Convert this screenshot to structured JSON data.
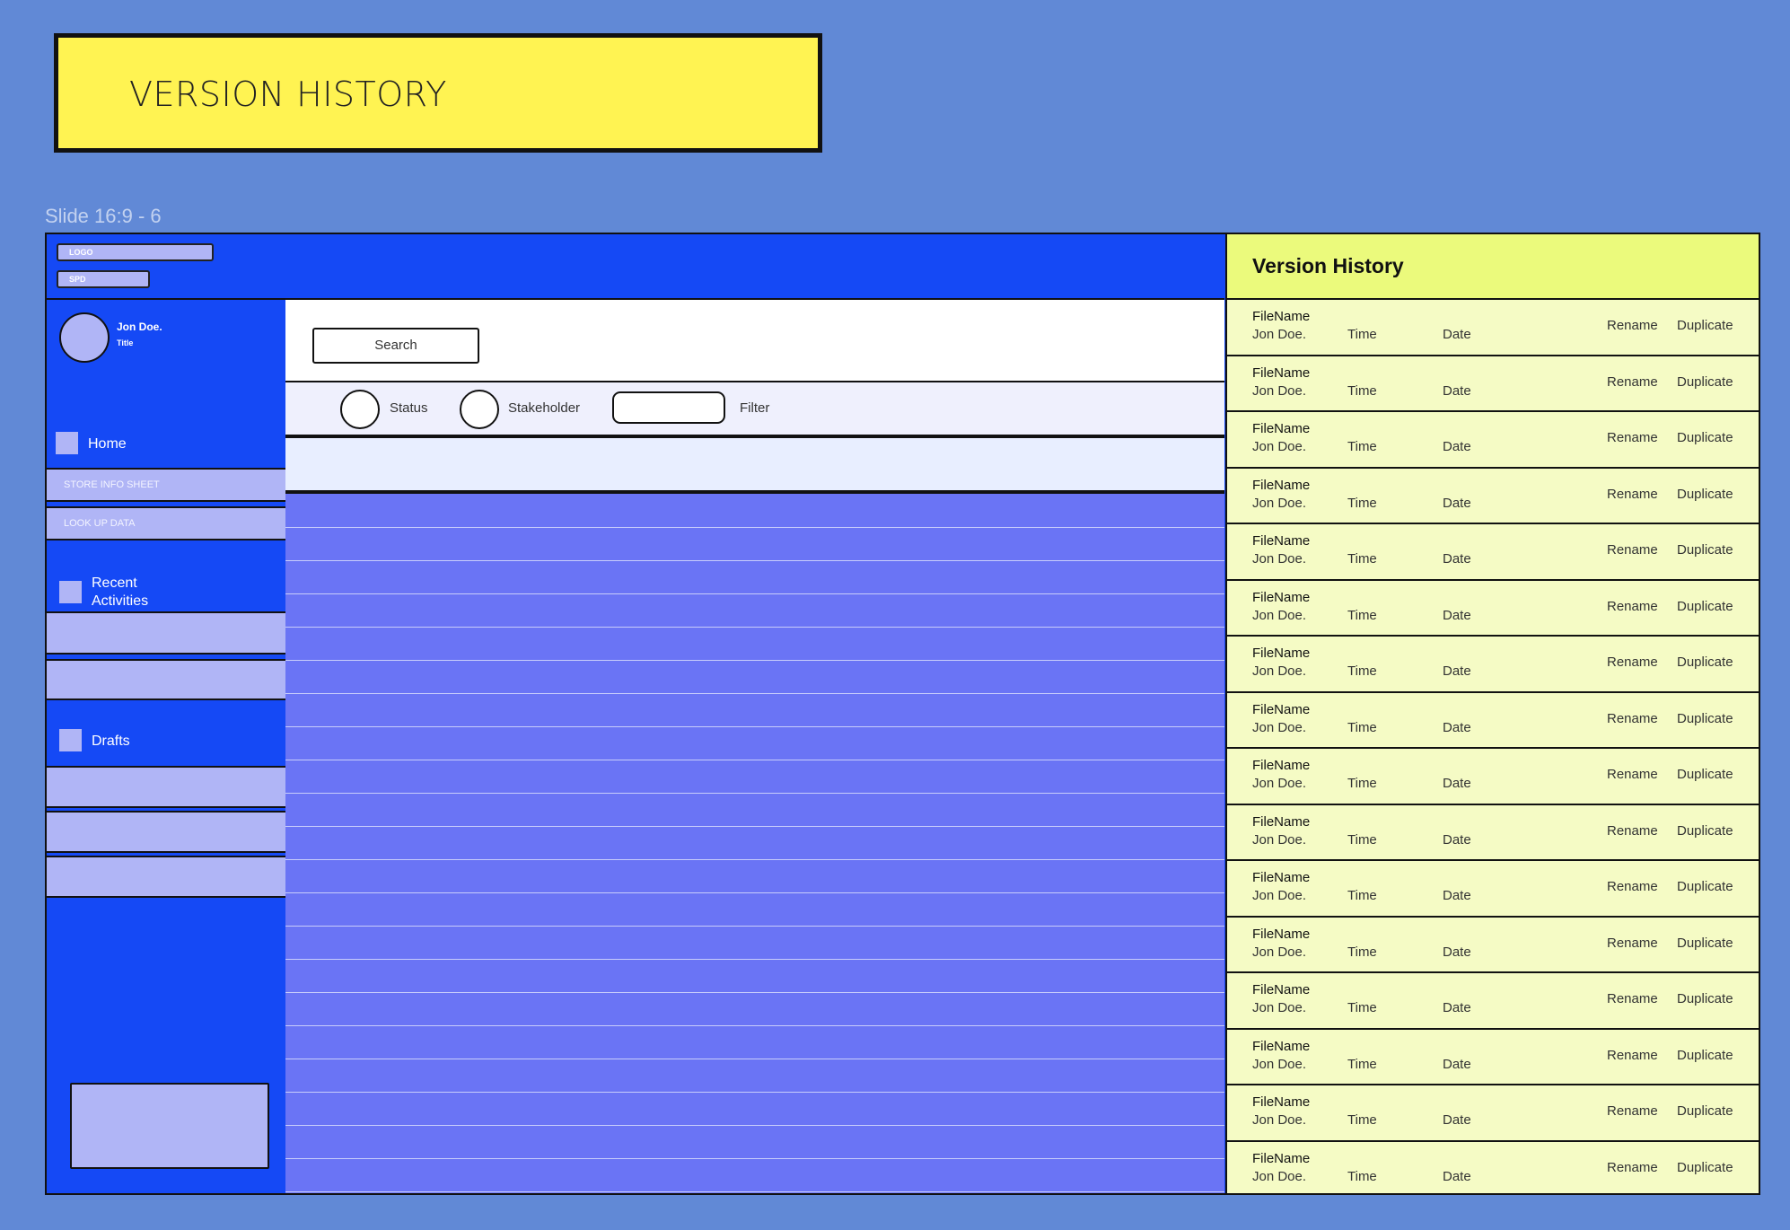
{
  "banner": {
    "title": "VERSION HISTORY"
  },
  "slide_label": "Slide 16:9 - 6",
  "topbar": {
    "logo": "LOGO",
    "spd": "SPD"
  },
  "sidebar": {
    "user_name": "Jon Doe.",
    "user_title": "Title",
    "home": "Home",
    "store_info": "STORE INFO SHEET",
    "look_up": "LOOK UP DATA",
    "recent_line1": "Recent",
    "recent_line2": "Activities",
    "drafts": "Drafts"
  },
  "toolbar": {
    "search": "Search",
    "status": "Status",
    "stakeholder": "Stakeholder",
    "filter": "Filter"
  },
  "version_panel": {
    "title": "Version History",
    "rows": [
      {
        "file": "FileName",
        "user": "Jon Doe.",
        "time": "Time",
        "date": "Date",
        "rename": "Rename",
        "duplicate": "Duplicate"
      },
      {
        "file": "FileName",
        "user": "Jon Doe.",
        "time": "Time",
        "date": "Date",
        "rename": "Rename",
        "duplicate": "Duplicate"
      },
      {
        "file": "FileName",
        "user": "Jon Doe.",
        "time": "Time",
        "date": "Date",
        "rename": "Rename",
        "duplicate": "Duplicate"
      },
      {
        "file": "FileName",
        "user": "Jon Doe.",
        "time": "Time",
        "date": "Date",
        "rename": "Rename",
        "duplicate": "Duplicate"
      },
      {
        "file": "FileName",
        "user": "Jon Doe.",
        "time": "Time",
        "date": "Date",
        "rename": "Rename",
        "duplicate": "Duplicate"
      },
      {
        "file": "FileName",
        "user": "Jon Doe.",
        "time": "Time",
        "date": "Date",
        "rename": "Rename",
        "duplicate": "Duplicate"
      },
      {
        "file": "FileName",
        "user": "Jon Doe.",
        "time": "Time",
        "date": "Date",
        "rename": "Rename",
        "duplicate": "Duplicate"
      },
      {
        "file": "FileName",
        "user": "Jon Doe.",
        "time": "Time",
        "date": "Date",
        "rename": "Rename",
        "duplicate": "Duplicate"
      },
      {
        "file": "FileName",
        "user": "Jon Doe.",
        "time": "Time",
        "date": "Date",
        "rename": "Rename",
        "duplicate": "Duplicate"
      },
      {
        "file": "FileName",
        "user": "Jon Doe.",
        "time": "Time",
        "date": "Date",
        "rename": "Rename",
        "duplicate": "Duplicate"
      },
      {
        "file": "FileName",
        "user": "Jon Doe.",
        "time": "Time",
        "date": "Date",
        "rename": "Rename",
        "duplicate": "Duplicate"
      },
      {
        "file": "FileName",
        "user": "Jon Doe.",
        "time": "Time",
        "date": "Date",
        "rename": "Rename",
        "duplicate": "Duplicate"
      },
      {
        "file": "FileName",
        "user": "Jon Doe.",
        "time": "Time",
        "date": "Date",
        "rename": "Rename",
        "duplicate": "Duplicate"
      },
      {
        "file": "FileName",
        "user": "Jon Doe.",
        "time": "Time",
        "date": "Date",
        "rename": "Rename",
        "duplicate": "Duplicate"
      },
      {
        "file": "FileName",
        "user": "Jon Doe.",
        "time": "Time",
        "date": "Date",
        "rename": "Rename",
        "duplicate": "Duplicate"
      },
      {
        "file": "FileName",
        "user": "Jon Doe.",
        "time": "Time",
        "date": "Date",
        "rename": "Rename",
        "duplicate": "Duplicate"
      }
    ]
  },
  "colors": {
    "background": "#6189d6",
    "banner": "#fff352",
    "primary": "#1549f5",
    "accent_light": "#b0b5f6",
    "table_body": "#6a74f5",
    "panel_bg": "#f5fbc5",
    "panel_header": "#ebfa7c"
  }
}
